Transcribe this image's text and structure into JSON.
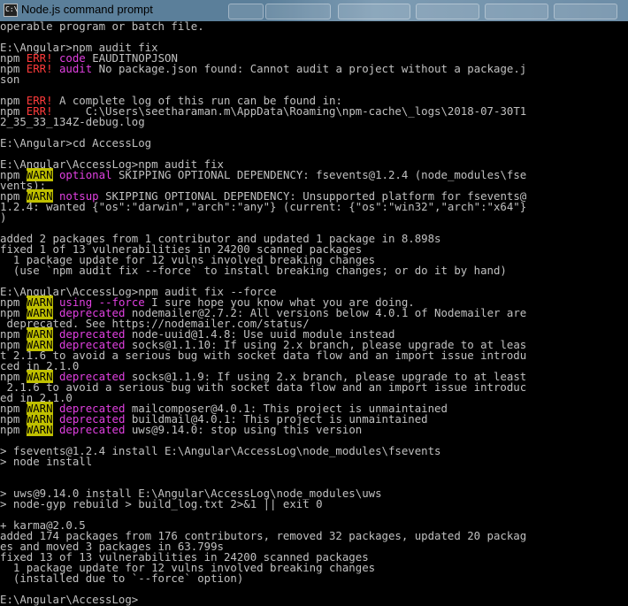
{
  "window": {
    "title": "Node.js command prompt",
    "icon_text": "C:\\"
  },
  "console": {
    "lines": [
      [
        {
          "t": "operable program or batch file."
        }
      ],
      [
        {
          "t": ""
        }
      ],
      [
        {
          "t": "E:\\Angular>npm audit fix"
        }
      ],
      [
        {
          "t": "npm "
        },
        {
          "t": "ERR!",
          "c": "err"
        },
        {
          "t": " "
        },
        {
          "t": "code",
          "c": "code"
        },
        {
          "t": " EAUDITNOPJSON"
        }
      ],
      [
        {
          "t": "npm "
        },
        {
          "t": "ERR!",
          "c": "err"
        },
        {
          "t": " "
        },
        {
          "t": "audit",
          "c": "code"
        },
        {
          "t": " No package.json found: Cannot audit a project without a package.j"
        }
      ],
      [
        {
          "t": "son"
        }
      ],
      [
        {
          "t": ""
        }
      ],
      [
        {
          "t": "npm "
        },
        {
          "t": "ERR!",
          "c": "err"
        },
        {
          "t": " A complete log of this run can be found in:"
        }
      ],
      [
        {
          "t": "npm "
        },
        {
          "t": "ERR!",
          "c": "err"
        },
        {
          "t": "     C:\\Users\\seetharaman.m\\AppData\\Roaming\\npm-cache\\_logs\\2018-07-30T1"
        }
      ],
      [
        {
          "t": "2_35_33_134Z-debug.log"
        }
      ],
      [
        {
          "t": ""
        }
      ],
      [
        {
          "t": "E:\\Angular>cd AccessLog"
        }
      ],
      [
        {
          "t": ""
        }
      ],
      [
        {
          "t": "E:\\Angular\\AccessLog>npm audit fix"
        }
      ],
      [
        {
          "t": "npm "
        },
        {
          "t": "WARN",
          "c": "warn"
        },
        {
          "t": " "
        },
        {
          "t": "optional",
          "c": "code"
        },
        {
          "t": " SKIPPING OPTIONAL DEPENDENCY: fsevents@1.2.4 (node_modules\\fse"
        }
      ],
      [
        {
          "t": "vents):"
        }
      ],
      [
        {
          "t": "npm "
        },
        {
          "t": "WARN",
          "c": "warn"
        },
        {
          "t": " "
        },
        {
          "t": "notsup",
          "c": "code"
        },
        {
          "t": " SKIPPING OPTIONAL DEPENDENCY: Unsupported platform for fsevents@"
        }
      ],
      [
        {
          "t": "1.2.4: wanted {\"os\":\"darwin\",\"arch\":\"any\"} (current: {\"os\":\"win32\",\"arch\":\"x64\"}"
        }
      ],
      [
        {
          "t": ")"
        }
      ],
      [
        {
          "t": ""
        }
      ],
      [
        {
          "t": "added 2 packages from 1 contributor and updated 1 package in 8.898s"
        }
      ],
      [
        {
          "t": "fixed 1 of 13 vulnerabilities in 24200 scanned packages"
        }
      ],
      [
        {
          "t": "  1 package update for 12 vulns involved breaking changes"
        }
      ],
      [
        {
          "t": "  (use `npm audit fix --force` to install breaking changes; or do it by hand)"
        }
      ],
      [
        {
          "t": ""
        }
      ],
      [
        {
          "t": "E:\\Angular\\AccessLog>npm audit fix --force"
        }
      ],
      [
        {
          "t": "npm "
        },
        {
          "t": "WARN",
          "c": "warn"
        },
        {
          "t": " "
        },
        {
          "t": "using --force",
          "c": "code"
        },
        {
          "t": " I sure hope you know what you are doing."
        }
      ],
      [
        {
          "t": "npm "
        },
        {
          "t": "WARN",
          "c": "warn"
        },
        {
          "t": " "
        },
        {
          "t": "deprecated",
          "c": "code"
        },
        {
          "t": " nodemailer@2.7.2: All versions below 4.0.1 of Nodemailer are"
        }
      ],
      [
        {
          "t": " deprecated. See https://nodemailer.com/status/"
        }
      ],
      [
        {
          "t": "npm "
        },
        {
          "t": "WARN",
          "c": "warn"
        },
        {
          "t": " "
        },
        {
          "t": "deprecated",
          "c": "code"
        },
        {
          "t": " node-uuid@1.4.8: Use uuid module instead"
        }
      ],
      [
        {
          "t": "npm "
        },
        {
          "t": "WARN",
          "c": "warn"
        },
        {
          "t": " "
        },
        {
          "t": "deprecated",
          "c": "code"
        },
        {
          "t": " socks@1.1.10: If using 2.x branch, please upgrade to at leas"
        }
      ],
      [
        {
          "t": "t 2.1.6 to avoid a serious bug with socket data flow and an import issue introdu"
        }
      ],
      [
        {
          "t": "ced in 2.1.0"
        }
      ],
      [
        {
          "t": "npm "
        },
        {
          "t": "WARN",
          "c": "warn"
        },
        {
          "t": " "
        },
        {
          "t": "deprecated",
          "c": "code"
        },
        {
          "t": " socks@1.1.9: If using 2.x branch, please upgrade to at least"
        }
      ],
      [
        {
          "t": " 2.1.6 to avoid a serious bug with socket data flow and an import issue introduc"
        }
      ],
      [
        {
          "t": "ed in 2.1.0"
        }
      ],
      [
        {
          "t": "npm "
        },
        {
          "t": "WARN",
          "c": "warn"
        },
        {
          "t": " "
        },
        {
          "t": "deprecated",
          "c": "code"
        },
        {
          "t": " mailcomposer@4.0.1: This project is unmaintained"
        }
      ],
      [
        {
          "t": "npm "
        },
        {
          "t": "WARN",
          "c": "warn"
        },
        {
          "t": " "
        },
        {
          "t": "deprecated",
          "c": "code"
        },
        {
          "t": " buildmail@4.0.1: This project is unmaintained"
        }
      ],
      [
        {
          "t": "npm "
        },
        {
          "t": "WARN",
          "c": "warn"
        },
        {
          "t": " "
        },
        {
          "t": "deprecated",
          "c": "code"
        },
        {
          "t": " uws@9.14.0: stop using this version"
        }
      ],
      [
        {
          "t": ""
        }
      ],
      [
        {
          "t": "> fsevents@1.2.4 install E:\\Angular\\AccessLog\\node_modules\\fsevents"
        }
      ],
      [
        {
          "t": "> node install"
        }
      ],
      [
        {
          "t": ""
        }
      ],
      [
        {
          "t": ""
        }
      ],
      [
        {
          "t": "> uws@9.14.0 install E:\\Angular\\AccessLog\\node_modules\\uws"
        }
      ],
      [
        {
          "t": "> node-gyp rebuild > build_log.txt 2>&1 || exit 0"
        }
      ],
      [
        {
          "t": ""
        }
      ],
      [
        {
          "t": "+ karma@2.0.5"
        }
      ],
      [
        {
          "t": "added 174 packages from 176 contributors, removed 32 packages, updated 20 packag"
        }
      ],
      [
        {
          "t": "es and moved 3 packages in 63.799s"
        }
      ],
      [
        {
          "t": "fixed 13 of 13 vulnerabilities in 24200 scanned packages"
        }
      ],
      [
        {
          "t": "  1 package update for 12 vulns involved breaking changes"
        }
      ],
      [
        {
          "t": "  (installed due to `--force` option)"
        }
      ],
      [
        {
          "t": ""
        }
      ],
      [
        {
          "t": "E:\\Angular\\AccessLog>"
        }
      ]
    ]
  }
}
